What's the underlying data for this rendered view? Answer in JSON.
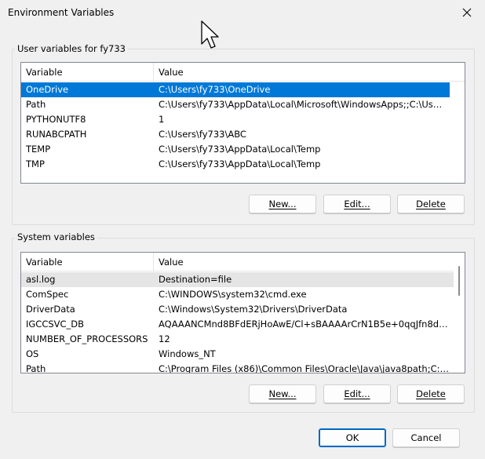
{
  "window": {
    "title": "Environment Variables"
  },
  "user_vars": {
    "label": "User variables for fy733",
    "columns": {
      "variable": "Variable",
      "value": "Value"
    },
    "rows": [
      {
        "variable": "OneDrive",
        "value": "C:\\Users\\fy733\\OneDrive",
        "state": "selected"
      },
      {
        "variable": "Path",
        "value": "C:\\Users\\fy733\\AppData\\Local\\Microsoft\\WindowsApps;;C:\\Users\\f...",
        "state": ""
      },
      {
        "variable": "PYTHONUTF8",
        "value": "1",
        "state": ""
      },
      {
        "variable": "RUNABCPATH",
        "value": "C:\\Users\\fy733\\ABC",
        "state": ""
      },
      {
        "variable": "TEMP",
        "value": "C:\\Users\\fy733\\AppData\\Local\\Temp",
        "state": ""
      },
      {
        "variable": "TMP",
        "value": "C:\\Users\\fy733\\AppData\\Local\\Temp",
        "state": ""
      }
    ],
    "buttons": {
      "new": "New...",
      "edit": "Edit...",
      "delete": "Delete"
    }
  },
  "system_vars": {
    "label": "System variables",
    "columns": {
      "variable": "Variable",
      "value": "Value"
    },
    "rows": [
      {
        "variable": "asl.log",
        "value": "Destination=file",
        "state": "hover"
      },
      {
        "variable": "ComSpec",
        "value": "C:\\WINDOWS\\system32\\cmd.exe",
        "state": ""
      },
      {
        "variable": "DriverData",
        "value": "C:\\Windows\\System32\\Drivers\\DriverData",
        "state": ""
      },
      {
        "variable": "IGCCSVC_DB",
        "value": "AQAAANCMnd8BFdERjHoAwE/Cl+sBAAAArCrN1B5e+0qqJfn8dHp...",
        "state": ""
      },
      {
        "variable": "NUMBER_OF_PROCESSORS",
        "value": "12",
        "state": ""
      },
      {
        "variable": "OS",
        "value": "Windows_NT",
        "state": ""
      },
      {
        "variable": "Path",
        "value": "C:\\Program Files (x86)\\Common Files\\Oracle\\Java\\java8path;C:\\Pro...",
        "state": ""
      }
    ],
    "buttons": {
      "new": "New...",
      "edit": "Edit...",
      "delete": "Delete"
    }
  },
  "footer": {
    "ok": "OK",
    "cancel": "Cancel"
  },
  "colors": {
    "selection": "#0078d7",
    "accent_border": "#0067c0",
    "hover": "#e5e5e5"
  },
  "icons": {
    "close": "close-icon",
    "cursor": "mouse-cursor-icon"
  }
}
